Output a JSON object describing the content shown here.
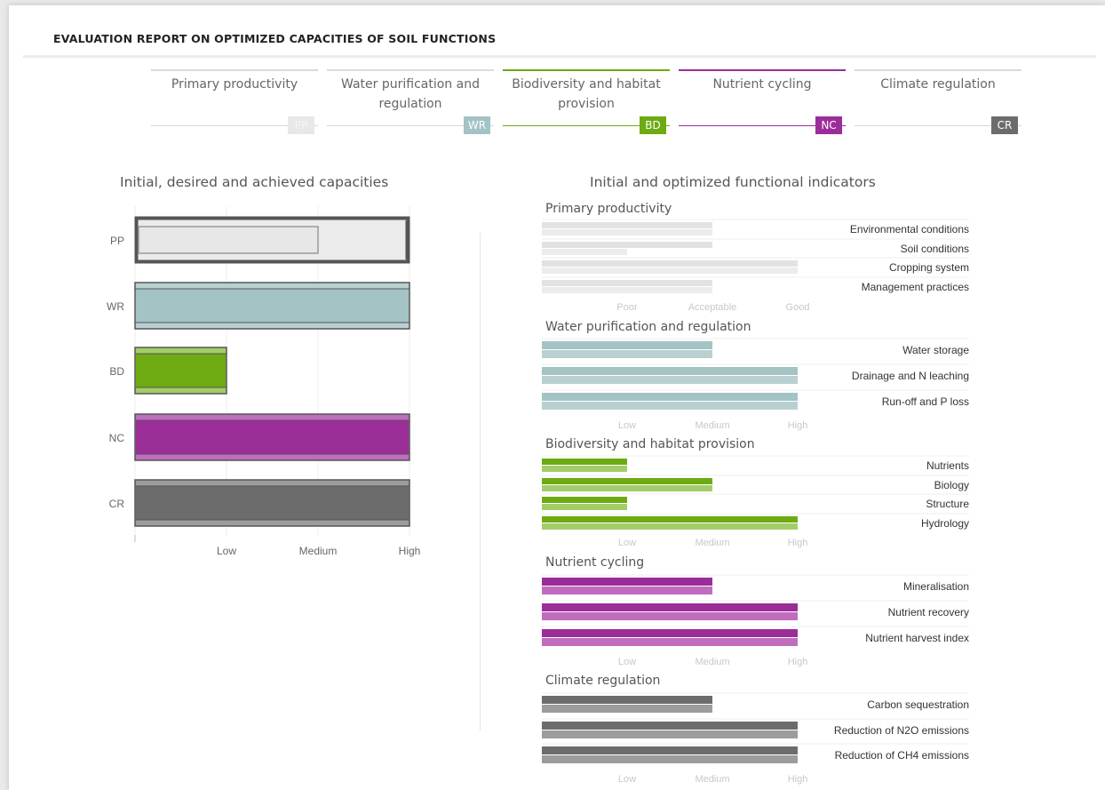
{
  "report_title": "EVALUATION REPORT ON OPTIMIZED CAPACITIES OF SOIL FUNCTIONS",
  "functions": [
    {
      "name": "Primary productivity",
      "code": "PP",
      "color": "#e0e0e0"
    },
    {
      "name": "Water purification and regulation",
      "code": "WR",
      "color": "#a3c3c4"
    },
    {
      "name": "Biodiversity and habitat provision",
      "code": "BD",
      "color": "#6eaa12"
    },
    {
      "name": "Nutrient cycling",
      "code": "NC",
      "color": "#9b2d99"
    },
    {
      "name": "Climate regulation",
      "code": "CR",
      "color": "#6c6c6c"
    }
  ],
  "colors": {
    "PP": "#e5e5e5",
    "PP_frame": "#555555",
    "WR": "#a3c3c4",
    "BD": "#6eaa12",
    "NC": "#9b2d99",
    "CR": "#6c6c6c",
    "WR_light": "#b9d0d1",
    "BD_light": "#a3cd68",
    "NC_light": "#c06dbf",
    "CR_light": "#9c9c9c"
  },
  "left_panel_title": "Initial, desired and achieved capacities",
  "right_panel_title": "Initial and optimized functional indicators",
  "chart_data": [
    {
      "type": "bar",
      "orientation": "horizontal",
      "title": "Initial, desired and achieved capacities",
      "categories": [
        "PP",
        "WR",
        "BD",
        "NC",
        "CR"
      ],
      "x_ticks": [
        "Low",
        "Medium",
        "High"
      ],
      "xlim": [
        0,
        3
      ],
      "series": [
        {
          "name": "initial",
          "values": [
            2,
            3,
            1,
            3,
            3
          ]
        },
        {
          "name": "desired",
          "values": [
            3,
            3,
            1,
            3,
            3
          ]
        },
        {
          "name": "achieved",
          "values": [
            3,
            3,
            1,
            3,
            3
          ]
        }
      ],
      "grid": true
    },
    {
      "type": "bar",
      "orientation": "horizontal",
      "title": "Initial and optimized functional indicators",
      "xlim": [
        0,
        3
      ],
      "groups": [
        {
          "name": "Primary productivity",
          "code": "PP",
          "ticks": [
            "Poor",
            "Acceptable",
            "Good"
          ],
          "indicators": [
            {
              "label": "Environmental conditions",
              "initial": 2,
              "optimized": 2
            },
            {
              "label": "Soil conditions",
              "initial": 2,
              "optimized": 1
            },
            {
              "label": "Cropping system",
              "initial": 3,
              "optimized": 3
            },
            {
              "label": "Management practices",
              "initial": 2,
              "optimized": 2
            }
          ]
        },
        {
          "name": "Water purification and regulation",
          "code": "WR",
          "ticks": [
            "Low",
            "Medium",
            "High"
          ],
          "indicators": [
            {
              "label": "Water storage",
              "initial": 2,
              "optimized": 2
            },
            {
              "label": "Drainage and N leaching",
              "initial": 3,
              "optimized": 3
            },
            {
              "label": "Run-off and P loss",
              "initial": 3,
              "optimized": 3
            }
          ]
        },
        {
          "name": "Biodiversity and habitat provision",
          "code": "BD",
          "ticks": [
            "Low",
            "Medium",
            "High"
          ],
          "indicators": [
            {
              "label": "Nutrients",
              "initial": 1,
              "optimized": 1
            },
            {
              "label": "Biology",
              "initial": 2,
              "optimized": 2
            },
            {
              "label": "Structure",
              "initial": 1,
              "optimized": 1
            },
            {
              "label": "Hydrology",
              "initial": 3,
              "optimized": 3
            }
          ]
        },
        {
          "name": "Nutrient cycling",
          "code": "NC",
          "ticks": [
            "Low",
            "Medium",
            "High"
          ],
          "indicators": [
            {
              "label": "Mineralisation",
              "initial": 2,
              "optimized": 2
            },
            {
              "label": "Nutrient recovery",
              "initial": 3,
              "optimized": 3
            },
            {
              "label": "Nutrient harvest index",
              "initial": 3,
              "optimized": 3
            }
          ]
        },
        {
          "name": "Climate regulation",
          "code": "CR",
          "ticks": [
            "Low",
            "Medium",
            "High"
          ],
          "indicators": [
            {
              "label": "Carbon sequestration",
              "initial": 2,
              "optimized": 2
            },
            {
              "label": "Reduction of N2O emissions",
              "initial": 3,
              "optimized": 3
            },
            {
              "label": "Reduction of CH4 emissions",
              "initial": 3,
              "optimized": 3
            }
          ]
        }
      ]
    }
  ]
}
